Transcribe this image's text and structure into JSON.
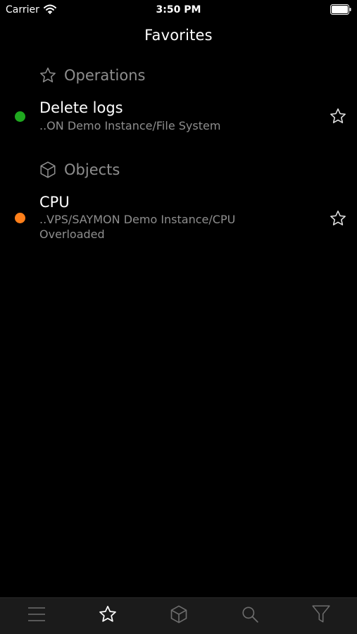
{
  "status_bar": {
    "carrier": "Carrier",
    "time": "3:50 PM",
    "wifi_icon": "wifi-icon",
    "battery_icon": "battery-full-icon"
  },
  "nav": {
    "title": "Favorites"
  },
  "sections": [
    {
      "title": "Operations",
      "icon": "star-outline-icon",
      "items": [
        {
          "title": "Delete logs",
          "path": "..ON Demo Instance/File System",
          "status_color": "#1fa81f",
          "favorite_icon": "star-outline-icon"
        }
      ]
    },
    {
      "title": "Objects",
      "icon": "cube-icon",
      "items": [
        {
          "title": "CPU",
          "path": "..VPS/SAYMON Demo Instance/CPU",
          "state": "Overloaded",
          "status_color": "#ff7f1a",
          "favorite_icon": "star-outline-icon"
        }
      ]
    }
  ],
  "tab_bar": {
    "tabs": [
      {
        "icon": "menu-icon",
        "selected": false
      },
      {
        "icon": "star-icon",
        "selected": true
      },
      {
        "icon": "cube-icon",
        "selected": false
      },
      {
        "icon": "search-icon",
        "selected": false
      },
      {
        "icon": "filter-icon",
        "selected": false
      }
    ]
  },
  "colors": {
    "background": "#000000",
    "text_primary": "#ffffff",
    "text_secondary": "#8e8e8e",
    "tab_bar_bg": "#1b1b1b",
    "tab_selected": "#ffffff",
    "tab_unselected": "#6e6e6e"
  }
}
